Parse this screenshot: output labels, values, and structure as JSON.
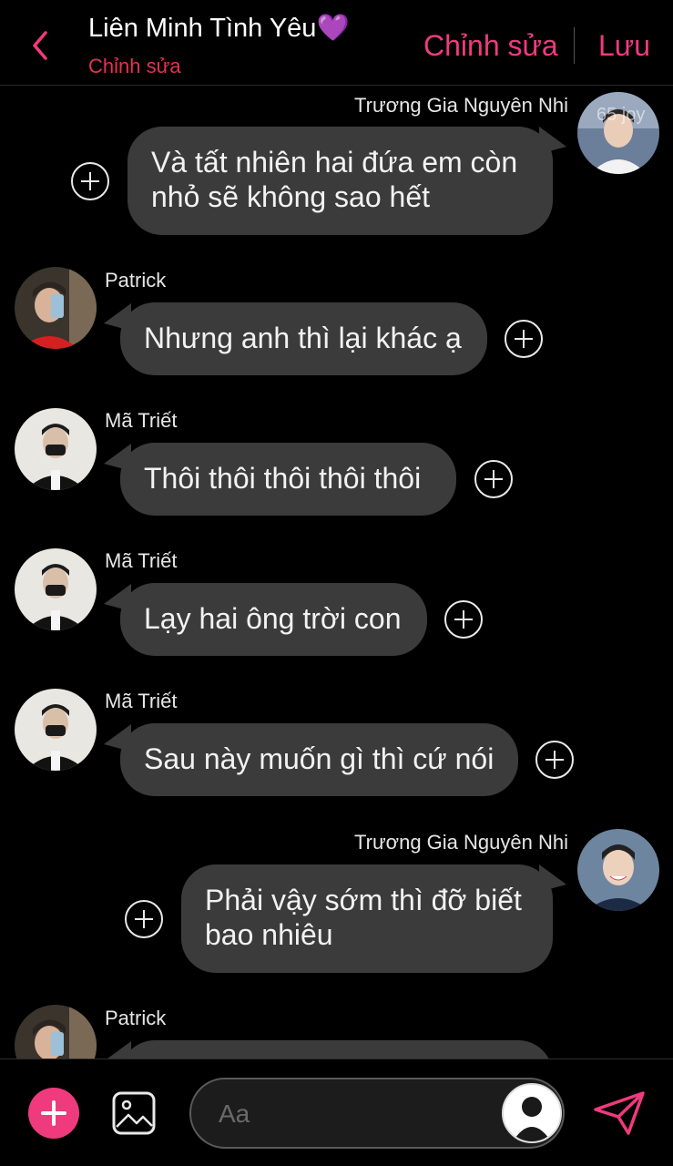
{
  "header": {
    "title": "Liên Minh Tình Yêu",
    "title_emoji": "💜",
    "subtitle": "Chỉnh sửa",
    "edit_label": "Chỉnh sửa",
    "save_label": "Lưu"
  },
  "messages": [
    {
      "sender": "Trương Gia Nguyên Nhi",
      "side": "right",
      "lines": [
        "Và tất nhiên hai đứa em còn",
        "nhỏ sẽ không sao hết"
      ],
      "watermark": "65 joy"
    },
    {
      "sender": "Patrick",
      "side": "left",
      "lines": [
        "Nhưng anh thì lại khác ạ"
      ]
    },
    {
      "sender": "Mã Triết",
      "side": "left",
      "lines": [
        "Thôi thôi thôi thôi thôi"
      ]
    },
    {
      "sender": "Mã Triết",
      "side": "left",
      "lines": [
        "Lạy hai ông trời con"
      ]
    },
    {
      "sender": "Mã Triết",
      "side": "left",
      "lines": [
        "Sau này muốn gì thì cứ nói"
      ]
    },
    {
      "sender": "Trương Gia Nguyên Nhi",
      "side": "right",
      "lines": [
        "Phải vậy sớm thì đỡ biết",
        "bao nhiêu"
      ]
    },
    {
      "sender": "Patrick",
      "side": "left",
      "lines": [
        ""
      ]
    }
  ],
  "composer": {
    "placeholder": "Aa"
  },
  "icons": {
    "back": "chevron-left-icon",
    "add": "plus-icon",
    "image": "image-icon",
    "send": "send-icon"
  },
  "colors": {
    "accent": "#f03a7e",
    "subtitle": "#e8304f",
    "bubble": "#3b3b3b",
    "background": "#000000",
    "heart": "#a64cf0"
  }
}
